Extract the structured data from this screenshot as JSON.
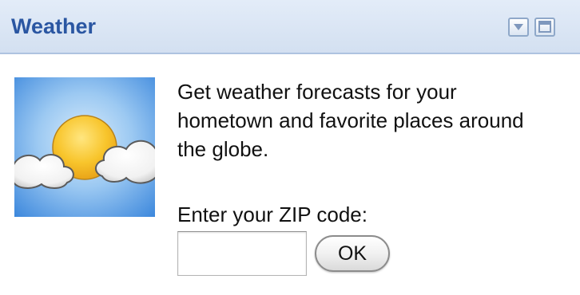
{
  "gadget": {
    "title": "Weather",
    "header_icons": {
      "menu": "dropdown-menu-icon",
      "maximize": "maximize-icon"
    },
    "image_icon": "sun-with-clouds-icon",
    "description": "Get weather forecasts for your hometown and favorite places around the globe.",
    "zip_label": "Enter your ZIP code:",
    "zip_input_value": "",
    "ok_label": "OK"
  },
  "colors": {
    "header_bg": "#d3e0f1",
    "title_text": "#2a56a2",
    "sky_blue": "#5aa2e6",
    "sun_yellow": "#f5c22a"
  }
}
